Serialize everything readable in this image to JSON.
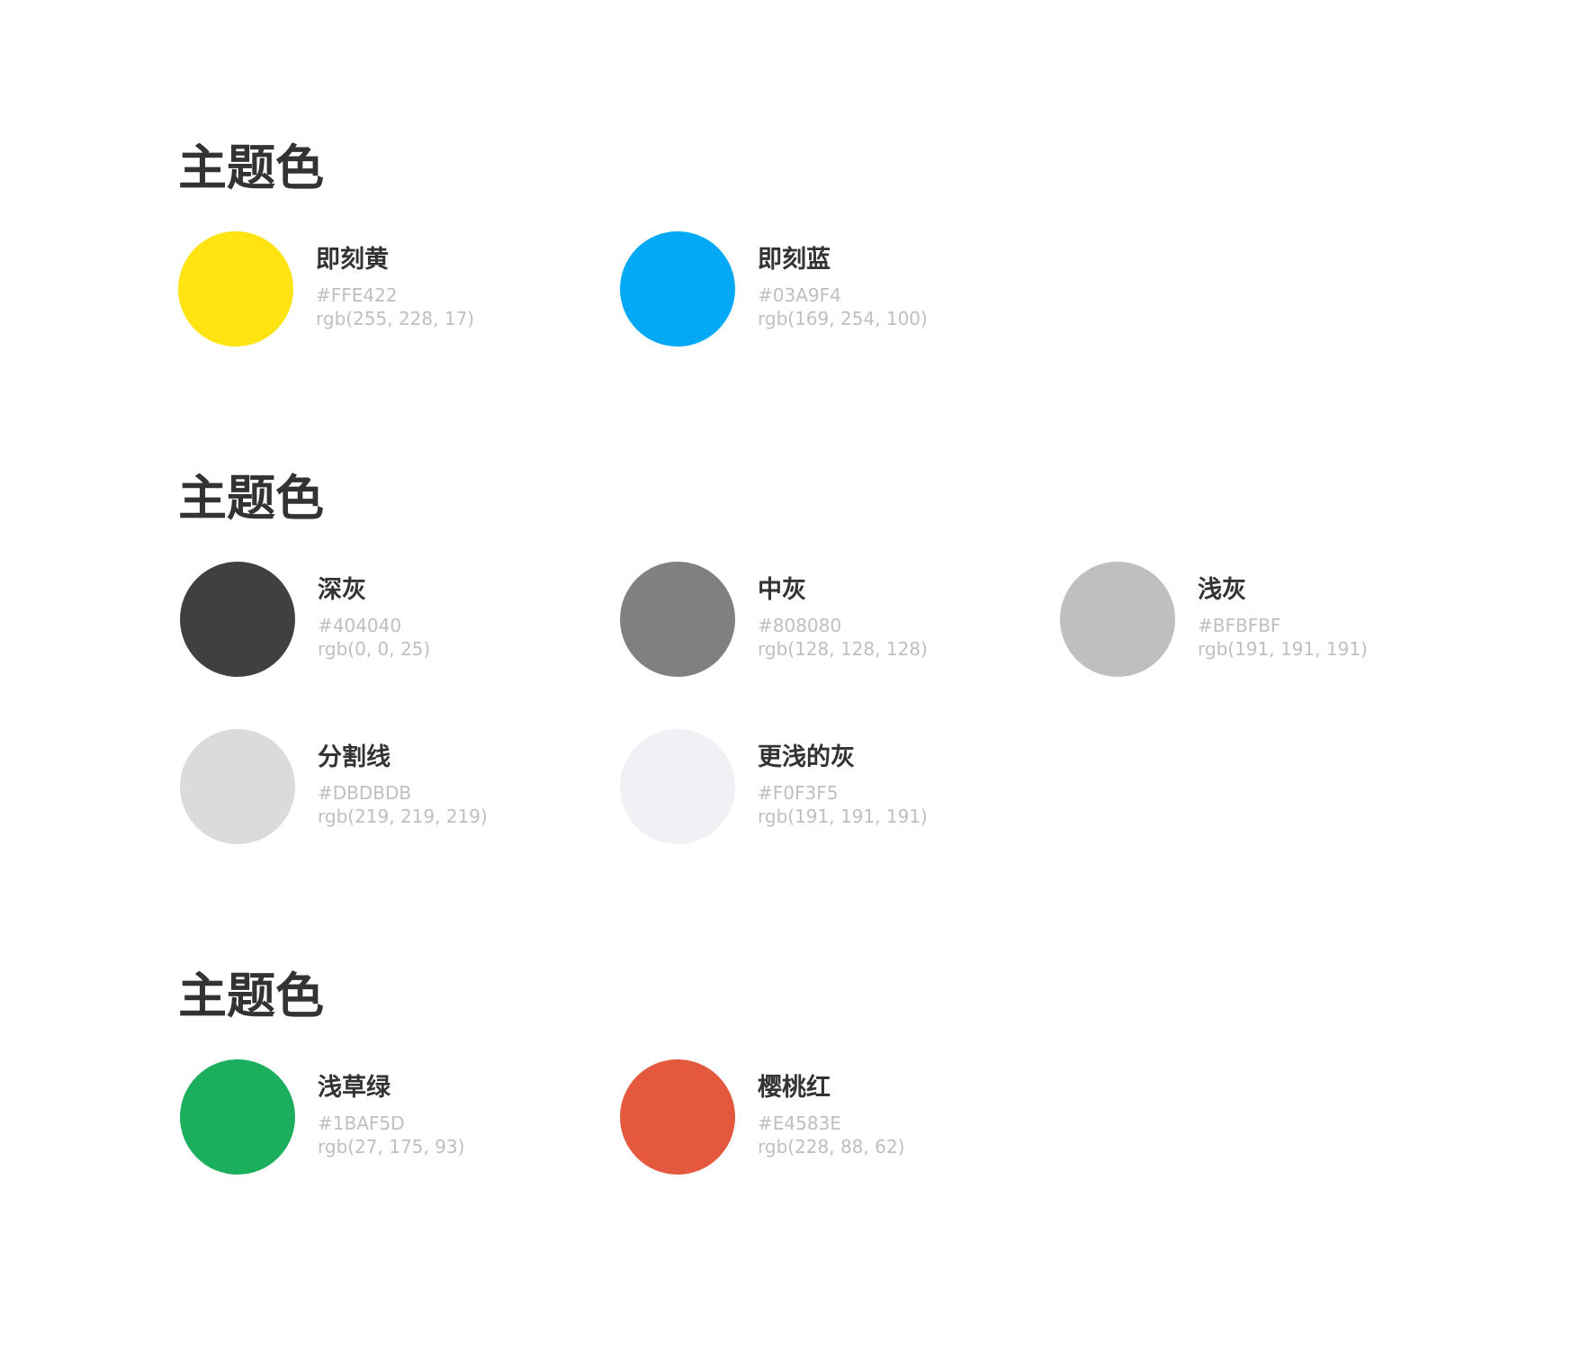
{
  "sections": [
    {
      "title": "主题色",
      "swatches": [
        {
          "name": "即刻黄",
          "hex": "#FFE422",
          "rgb": "rgb(255, 228, 17)",
          "color": "#FFE411"
        },
        {
          "name": "即刻蓝",
          "hex": "#03A9F4",
          "rgb": "rgb(169, 254, 100)",
          "color": "#03A9F4"
        }
      ]
    },
    {
      "title": "主题色",
      "swatches": [
        {
          "name": "深灰",
          "hex": "#404040",
          "rgb": "rgb(0, 0, 25)",
          "color": "#404040"
        },
        {
          "name": "中灰",
          "hex": "#808080",
          "rgb": "rgb(128, 128, 128)",
          "color": "#808080"
        },
        {
          "name": "浅灰",
          "hex": "#BFBFBF",
          "rgb": "rgb(191, 191, 191)",
          "color": "#BFBFBF"
        },
        {
          "name": "分割线",
          "hex": "#DBDBDB",
          "rgb": "rgb(219, 219, 219)",
          "color": "#DBDBDB"
        },
        {
          "name": "更浅的灰",
          "hex": "#F0F3F5",
          "rgb": "rgb(191, 191, 191)",
          "color": "#F0F1F4"
        }
      ]
    },
    {
      "title": "主题色",
      "swatches": [
        {
          "name": "浅草绿",
          "hex": "#1BAF5D",
          "rgb": "rgb(27, 175, 93)",
          "color": "#1BAF5D"
        },
        {
          "name": "樱桃红",
          "hex": "#E4583E",
          "rgb": "rgb(228, 88, 62)",
          "color": "#E4583E"
        }
      ]
    }
  ]
}
